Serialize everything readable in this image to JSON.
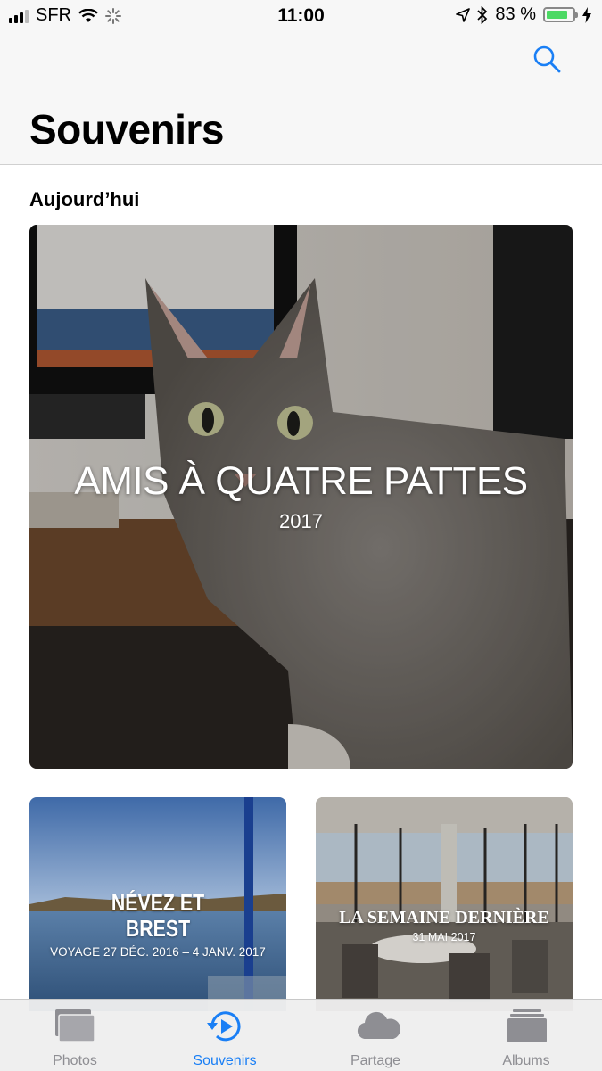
{
  "status_bar": {
    "carrier": "SFR",
    "time": "11:00",
    "battery_text": "83 %",
    "battery_level": 0.83,
    "battery_color": "#4cd964"
  },
  "header": {
    "title": "Souvenirs",
    "search_icon": "magnifying-glass-icon"
  },
  "section": {
    "title": "Aujourd’hui"
  },
  "featured": {
    "title": "AMIS À QUATRE PATTES",
    "subtitle": "2017"
  },
  "memories": [
    {
      "title_line1": "NÉVEZ ET",
      "title_line2": "BREST",
      "subtitle": "VOYAGE 27 DÉC. 2016 – 4 JANV. 2017"
    },
    {
      "title": "LA SEMAINE DERNIÈRE",
      "subtitle": "31 MAI 2017"
    }
  ],
  "tabs": [
    {
      "label": "Photos",
      "icon": "photos-stack-icon"
    },
    {
      "label": "Souvenirs",
      "icon": "memories-play-icon"
    },
    {
      "label": "Partage",
      "icon": "cloud-icon"
    },
    {
      "label": "Albums",
      "icon": "albums-icon"
    }
  ],
  "colors": {
    "accent": "#1a7ff5",
    "inactive": "#8e8e93"
  }
}
